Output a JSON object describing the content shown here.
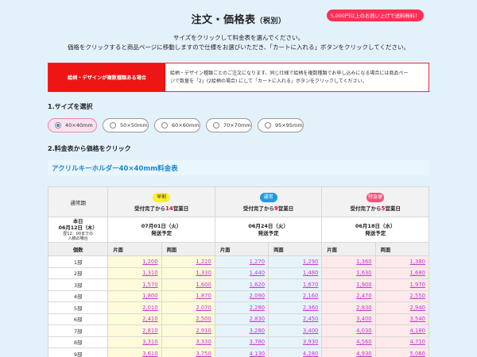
{
  "header": {
    "title": "注文・価格表",
    "title_sub": "（税別）",
    "free_shipping_badge": "5,000円以上のお買い上げで送料無料！"
  },
  "intro": {
    "line1": "サイズをクリックして料金表を選んでください。",
    "line2": "価格をクリックすると商品ページに移動しますので仕様をお選びいただき、「カートに入れる」ボタンをクリックしてください。"
  },
  "notice": {
    "label": "絵柄・デザインが複数種類ある場合",
    "line1": "絵柄・デザイン種類ごとのご注文になります。同じ仕様で絵柄を複数種類でお申し込みになる場合には商品ペー",
    "line2": "ジで数量を「2」(2絵柄の場合) にして「カートに入れる」ボタンをクリックしてください。"
  },
  "section1": {
    "title": "1.サイズを選択"
  },
  "sizes": [
    {
      "label": "40×40mm",
      "selected": true
    },
    {
      "label": "50×50mm",
      "selected": false
    },
    {
      "label": "60×60mm",
      "selected": false
    },
    {
      "label": "70×70mm",
      "selected": false
    },
    {
      "label": "95×95mm",
      "selected": false
    }
  ],
  "section2": {
    "title": "2.料金表から価格をクリック"
  },
  "price_table": {
    "heading": "アクリルキーホルダー40×40mm料金表",
    "corner_label": "通常期",
    "today_line1": "本日",
    "today_line2": "06月12日（木）",
    "today_note1": "昼12：00までの",
    "today_note2": "入稿の場合",
    "qty_header": "個数",
    "side_single": "片面",
    "side_double": "両面",
    "tiers": [
      {
        "badge": "早割",
        "badge_color": "#ffee33",
        "badge_text_color": "#333333",
        "pre": "受付完了から",
        "days": "14",
        "post": "営業日",
        "days_color": "#e4002b",
        "ship_date": "07月01日（火）",
        "ship_label": "発送予定"
      },
      {
        "badge": "通常",
        "badge_color": "#1e9be0",
        "badge_text_color": "#ffffff",
        "pre": "受付完了から",
        "days": "9",
        "post": "営業日",
        "days_color": "#e4002b",
        "ship_date": "06月24日（火）",
        "ship_label": "発送予定"
      },
      {
        "badge": "特急便",
        "badge_color": "#f0527a",
        "badge_text_color": "#ffffff",
        "pre": "受付完了から",
        "days": "5",
        "post": "営業日",
        "days_color": "#e4002b",
        "ship_date": "06月18日（水）",
        "ship_label": "発送予定"
      }
    ],
    "rows": [
      {
        "qty": "1部",
        "prices": [
          "1,200",
          "1,220",
          "1,270",
          "1,290",
          "1,360",
          "1,380"
        ]
      },
      {
        "qty": "2部",
        "prices": [
          "1,310",
          "1,330",
          "1,440",
          "1,480",
          "1,630",
          "1,680"
        ]
      },
      {
        "qty": "3部",
        "prices": [
          "1,570",
          "1,600",
          "1,620",
          "1,670",
          "1,900",
          "1,970"
        ]
      },
      {
        "qty": "4部",
        "prices": [
          "1,800",
          "1,870",
          "2,090",
          "2,160",
          "2,470",
          "2,550"
        ]
      },
      {
        "qty": "5部",
        "prices": [
          "2,010",
          "2,070",
          "2,280",
          "2,360",
          "2,830",
          "2,940"
        ]
      },
      {
        "qty": "6部",
        "prices": [
          "2,410",
          "2,500",
          "2,830",
          "2,450",
          "3,400",
          "3,540"
        ]
      },
      {
        "qty": "7部",
        "prices": [
          "2,810",
          "2,910",
          "3,280",
          "3,400",
          "4,030",
          "4,180"
        ]
      },
      {
        "qty": "8部",
        "prices": [
          "3,310",
          "3,330",
          "3,780",
          "3,930",
          "4,560",
          "4,710"
        ]
      },
      {
        "qty": "9部",
        "prices": [
          "3,610",
          "3,750",
          "4,130",
          "4,280",
          "4,930",
          "5,060"
        ]
      }
    ]
  }
}
